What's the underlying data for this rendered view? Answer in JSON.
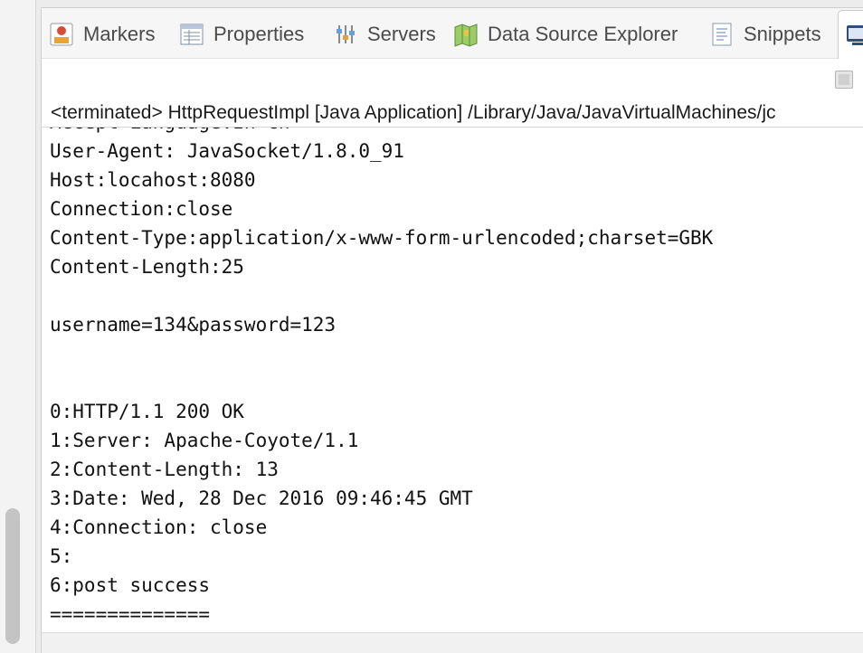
{
  "tabs": [
    {
      "label": "Markers",
      "icon": "markers-icon"
    },
    {
      "label": "Properties",
      "icon": "properties-icon"
    },
    {
      "label": "Servers",
      "icon": "servers-icon"
    },
    {
      "label": "Data Source Explorer",
      "icon": "data-source-explorer-icon"
    },
    {
      "label": "Snippets",
      "icon": "snippets-icon"
    },
    {
      "label": "",
      "icon": "console-icon"
    }
  ],
  "console": {
    "label": "<terminated> HttpRequestImpl [Java Application] /Library/Java/JavaVirtualMachines/jc",
    "lines": [
      "Accept-Language:zh-cn",
      "User-Agent: JavaSocket/1.8.0_91",
      "Host:locahost:8080",
      "Connection:close",
      "Content-Type:application/x-www-form-urlencoded;charset=GBK",
      "Content-Length:25",
      "",
      "username=134&password=123",
      "",
      "",
      "0:HTTP/1.1 200 OK",
      "1:Server: Apache-Coyote/1.1",
      "2:Content-Length: 13",
      "3:Date: Wed, 28 Dec 2016 09:46:45 GMT",
      "4:Connection: close",
      "5:",
      "6:post success",
      "=============="
    ]
  },
  "colors": {
    "panel_bg": "#ffffff",
    "tab_text": "#4a4a4a",
    "console_text": "#111111"
  }
}
